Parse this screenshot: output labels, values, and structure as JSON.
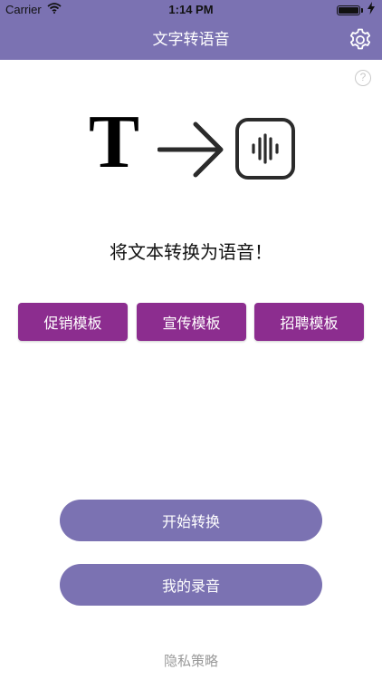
{
  "status_bar": {
    "carrier": "Carrier",
    "time": "1:14 PM",
    "battery_level": 1.0
  },
  "nav": {
    "title": "文字转语音",
    "settings_icon": "gear-icon"
  },
  "help": {
    "icon": "question-circle-icon",
    "glyph": "?"
  },
  "hero": {
    "letter": "T",
    "arrow_icon": "arrow-right-icon",
    "audio_icon": "audio-waveform-icon"
  },
  "headline": "将文本转换为语音！",
  "templates": [
    {
      "label": "促销模板"
    },
    {
      "label": "宣传模板"
    },
    {
      "label": "招聘模板"
    }
  ],
  "actions": {
    "start_label": "开始转换",
    "records_label": "我的录音"
  },
  "footer": {
    "privacy_label": "隐私策略"
  },
  "colors": {
    "nav_bg": "#7b72b2",
    "template_btn": "#8c2d8f",
    "pill_btn": "#7b72b2",
    "privacy_text": "#9a9a9a"
  }
}
